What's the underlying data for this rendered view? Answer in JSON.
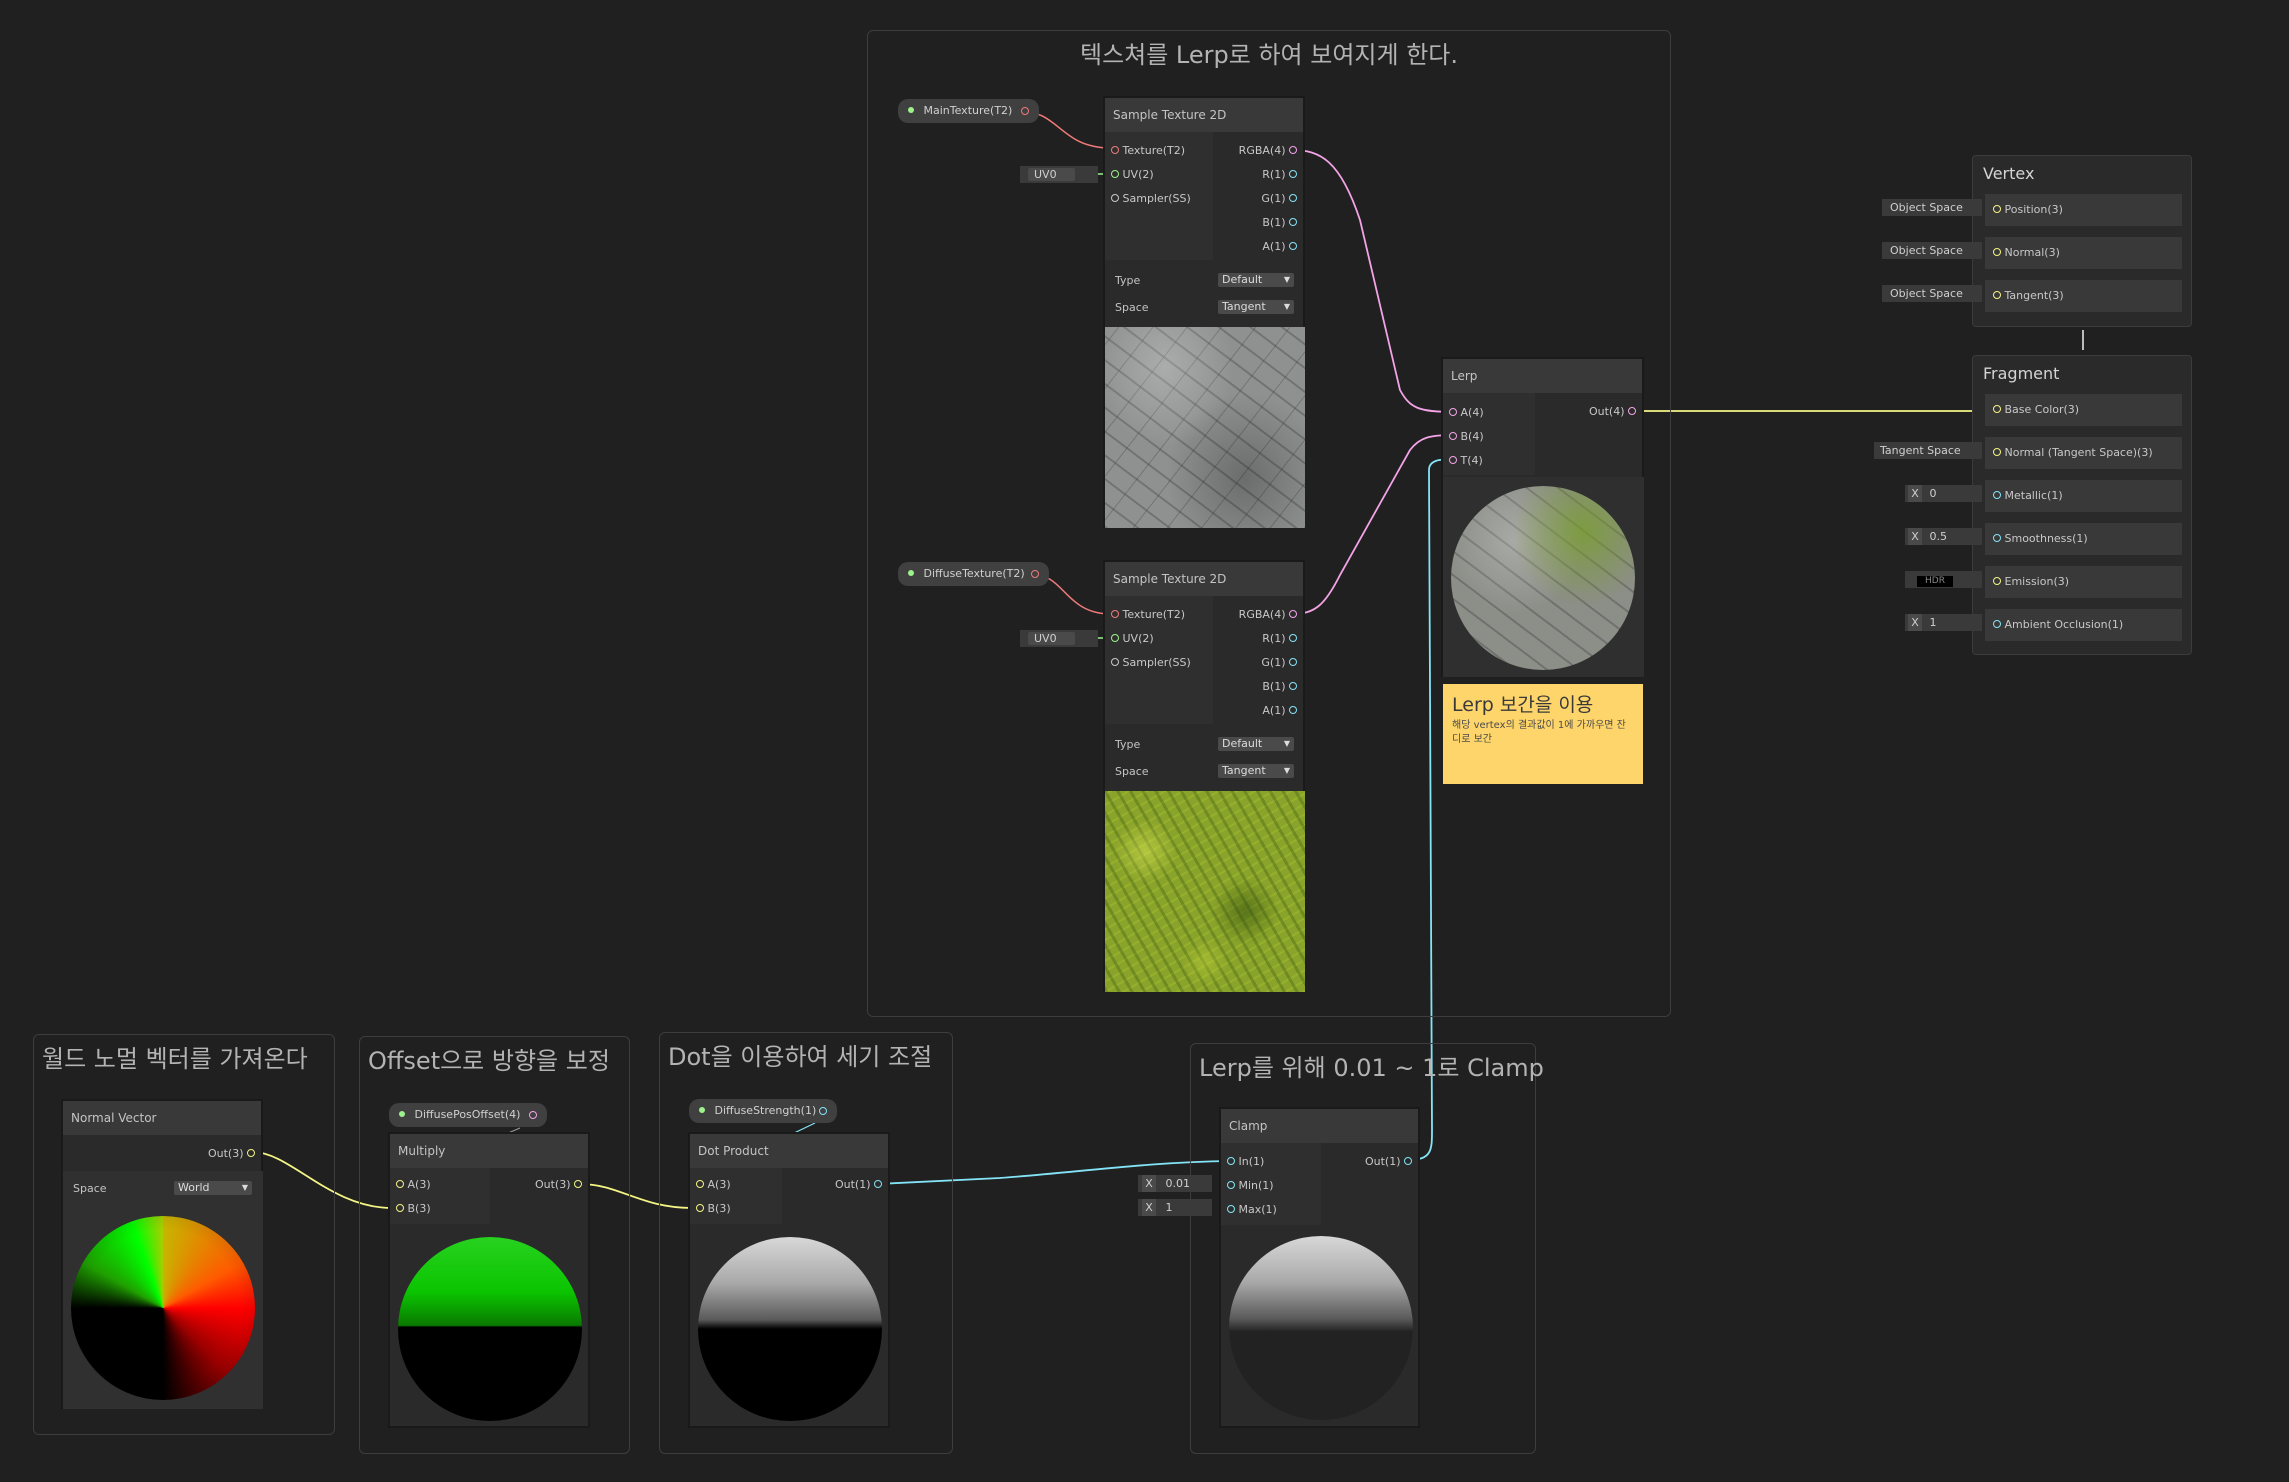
{
  "groups": {
    "texture_lerp": "텍스쳐를 Lerp로 하여 보여지게 한다.",
    "world_normal": "월드 노멀 벡터를 가져온다",
    "offset": "Offset으로 방향을 보정",
    "dot": "Dot을 이용하여 세기 조절",
    "clamp": "Lerp를 위해 0.01 ~ 1로 Clamp"
  },
  "properties": {
    "main_texture": "MainTexture(T2)",
    "diffuse_texture": "DiffuseTexture(T2)",
    "diffuse_pos_offset": "DiffusePosOffset(4)",
    "diffuse_strength": "DiffuseStrength(1)"
  },
  "sample1": {
    "title": "Sample Texture 2D",
    "in_texture": "Texture(T2)",
    "in_uv": "UV(2)",
    "in_sampler": "Sampler(SS)",
    "out_rgba": "RGBA(4)",
    "out_r": "R(1)",
    "out_g": "G(1)",
    "out_b": "B(1)",
    "out_a": "A(1)",
    "type_label": "Type",
    "type_value": "Default",
    "space_label": "Space",
    "space_value": "Tangent",
    "uv_value": "UV0"
  },
  "sample2": {
    "title": "Sample Texture 2D",
    "in_texture": "Texture(T2)",
    "in_uv": "UV(2)",
    "in_sampler": "Sampler(SS)",
    "out_rgba": "RGBA(4)",
    "out_r": "R(1)",
    "out_g": "G(1)",
    "out_b": "B(1)",
    "out_a": "A(1)",
    "type_label": "Type",
    "type_value": "Default",
    "space_label": "Space",
    "space_value": "Tangent",
    "uv_value": "UV0"
  },
  "lerp": {
    "title": "Lerp",
    "in_a": "A(4)",
    "in_b": "B(4)",
    "in_t": "T(4)",
    "out": "Out(4)"
  },
  "sticky": {
    "title": "Lerp 보간을 이용",
    "body": "해당 vertex의 결과값이 1에 가까우면 잔디로 보간"
  },
  "normal_vector": {
    "title": "Normal Vector",
    "out": "Out(3)",
    "space_label": "Space",
    "space_value": "World"
  },
  "multiply": {
    "title": "Multiply",
    "in_a": "A(3)",
    "in_b": "B(3)",
    "out": "Out(3)"
  },
  "dot_product": {
    "title": "Dot Product",
    "in_a": "A(3)",
    "in_b": "B(3)",
    "out": "Out(1)"
  },
  "clamp": {
    "title": "Clamp",
    "in": "In(1)",
    "min": "Min(1)",
    "max": "Max(1)",
    "out": "Out(1)",
    "min_value": "0.01",
    "max_value": "1",
    "x_label": "X"
  },
  "vertex": {
    "title": "Vertex",
    "slots": [
      "Position(3)",
      "Normal(3)",
      "Tangent(3)"
    ],
    "inputs": [
      "Object Space",
      "Object Space",
      "Object Space"
    ]
  },
  "fragment": {
    "title": "Fragment",
    "slots": [
      "Base Color(3)",
      "Normal (Tangent Space)(3)",
      "Metallic(1)",
      "Smoothness(1)",
      "Emission(3)",
      "Ambient Occlusion(1)"
    ],
    "normal_input": "Tangent Space",
    "x_label": "X",
    "metallic_value": "0",
    "smoothness_value": "0.5",
    "emission_value": "HDR",
    "ao_value": "1"
  },
  "colors": {
    "texture_port": "#f07a7a",
    "vector4_port": "#f3a3e6",
    "vector3_port": "#f4f585",
    "vector2_port": "#9ef28b",
    "vector1_port": "#84e4f7",
    "sticky_bg": "#fed56b"
  }
}
